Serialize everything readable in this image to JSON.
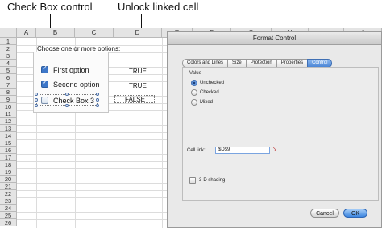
{
  "callouts": {
    "check_box_control": "Check Box control",
    "unlock_linked_cell": "Unlock linked cell"
  },
  "sheet": {
    "columns": [
      "A",
      "B",
      "C",
      "D",
      "E",
      "F",
      "G",
      "H",
      "I",
      "J"
    ],
    "rows": [
      "1",
      "2",
      "3",
      "4",
      "5",
      "6",
      "7",
      "8",
      "9",
      "10",
      "11",
      "12",
      "13",
      "14",
      "15",
      "16",
      "17",
      "18",
      "19",
      "20",
      "21",
      "22",
      "23",
      "24",
      "25",
      "26"
    ],
    "instruction": "Choose one or more options:",
    "cells": {
      "d5": "TRUE",
      "d7": "TRUE",
      "d9": "FALSE"
    }
  },
  "checkboxes": [
    {
      "label": "First option",
      "checked": true
    },
    {
      "label": "Second option",
      "checked": true
    },
    {
      "label": "Check Box 3",
      "checked": false
    }
  ],
  "dialog": {
    "title": "Format Control",
    "tabs": [
      "Colors and Lines",
      "Size",
      "Protection",
      "Properties",
      "Control"
    ],
    "active_tab": "Control",
    "value_label": "Value",
    "radios": [
      {
        "label": "Unchecked",
        "selected": true
      },
      {
        "label": "Checked",
        "selected": false
      },
      {
        "label": "Mixed",
        "selected": false
      }
    ],
    "cell_link_label": "Cell link:",
    "cell_link_value": "$D$9",
    "shading_label": "3-D shading",
    "cancel_label": "Cancel",
    "ok_label": "OK"
  },
  "colors": {
    "accent": "#4b86d6",
    "header_bg": "#e4e4e4",
    "dialog_bg": "#e9e9e9"
  }
}
